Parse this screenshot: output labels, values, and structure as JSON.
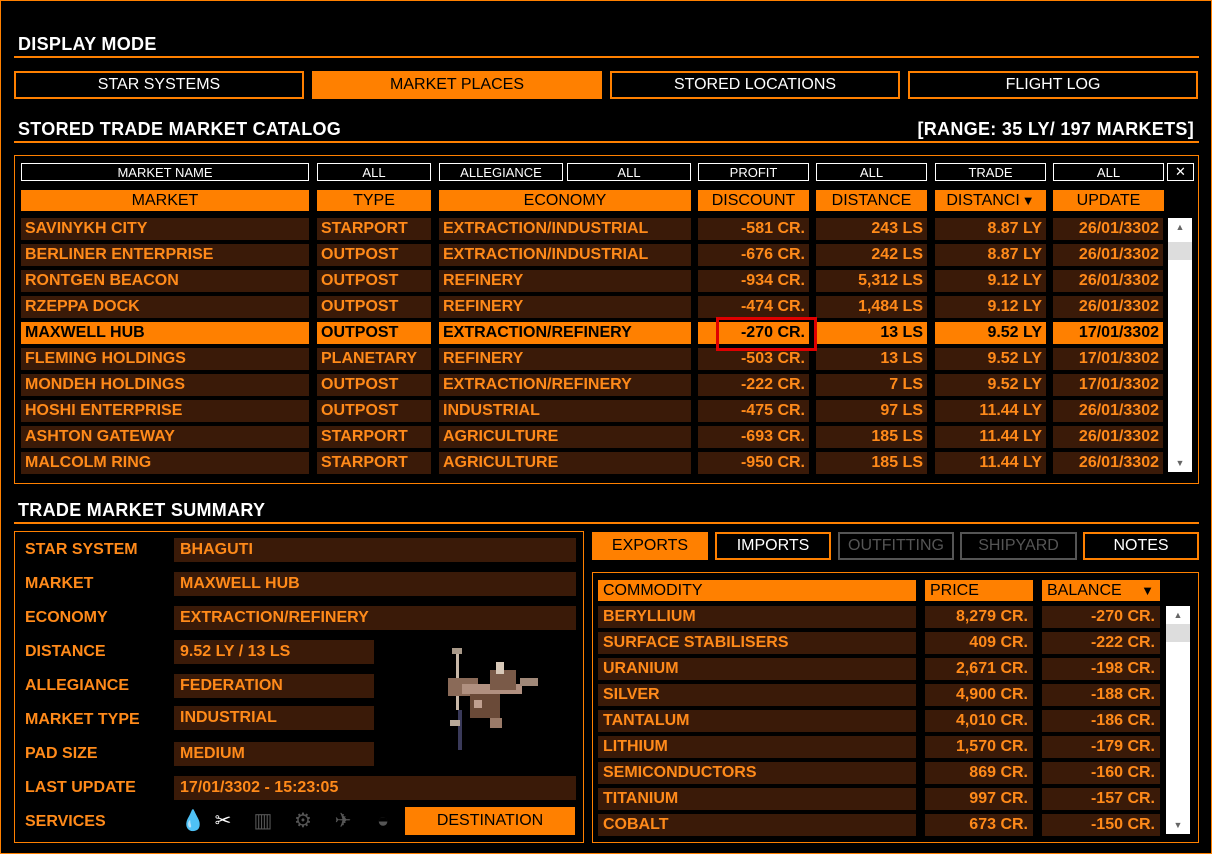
{
  "display_mode": {
    "title": "DISPLAY MODE",
    "buttons": [
      {
        "label": "STAR SYSTEMS"
      },
      {
        "label": "MARKET PLACES"
      },
      {
        "label": "STORED LOCATIONS"
      },
      {
        "label": "FLIGHT LOG"
      }
    ]
  },
  "catalog": {
    "title": "STORED TRADE MARKET CATALOG",
    "range": "[RANGE: 35 LY/ 197 MARKETS]",
    "filters": {
      "market_name": "MARKET NAME",
      "type_filter": "ALL",
      "allegiance": "ALLEGIANCE",
      "allegiance_filter": "ALL",
      "profit": "PROFIT",
      "profit_filter": "ALL",
      "trade": "TRADE",
      "trade_filter": "ALL",
      "close": "✕"
    },
    "columns": {
      "market": "MARKET",
      "type": "TYPE",
      "economy": "ECONOMY",
      "discount": "DISCOUNT",
      "distance": "DISTANCE",
      "distance_ly": "DISTANCI",
      "update": "UPDATE"
    },
    "rows": [
      {
        "market": "SAVINYKH CITY",
        "type": "STARPORT",
        "economy": "EXTRACTION/INDUSTRIAL",
        "discount": "-581 CR.",
        "distance": "243 LS",
        "distance_ly": "8.87 LY",
        "update": "26/01/3302"
      },
      {
        "market": "BERLINER ENTERPRISE",
        "type": "OUTPOST",
        "economy": "EXTRACTION/INDUSTRIAL",
        "discount": "-676 CR.",
        "distance": "242 LS",
        "distance_ly": "8.87 LY",
        "update": "26/01/3302"
      },
      {
        "market": "RONTGEN BEACON",
        "type": "OUTPOST",
        "economy": "REFINERY",
        "discount": "-934 CR.",
        "distance": "5,312 LS",
        "distance_ly": "9.12 LY",
        "update": "26/01/3302"
      },
      {
        "market": "RZEPPA DOCK",
        "type": "OUTPOST",
        "economy": "REFINERY",
        "discount": "-474 CR.",
        "distance": "1,484 LS",
        "distance_ly": "9.12 LY",
        "update": "26/01/3302"
      },
      {
        "market": "MAXWELL HUB",
        "type": "OUTPOST",
        "economy": "EXTRACTION/REFINERY",
        "discount": "-270 CR.",
        "distance": "13 LS",
        "distance_ly": "9.52 LY",
        "update": "17/01/3302"
      },
      {
        "market": "FLEMING HOLDINGS",
        "type": "PLANETARY",
        "economy": "REFINERY",
        "discount": "-503 CR.",
        "distance": "13 LS",
        "distance_ly": "9.52 LY",
        "update": "17/01/3302"
      },
      {
        "market": "MONDEH HOLDINGS",
        "type": "OUTPOST",
        "economy": "EXTRACTION/REFINERY",
        "discount": "-222 CR.",
        "distance": "7 LS",
        "distance_ly": "9.52 LY",
        "update": "17/01/3302"
      },
      {
        "market": "HOSHI ENTERPRISE",
        "type": "OUTPOST",
        "economy": "INDUSTRIAL",
        "discount": "-475 CR.",
        "distance": "97 LS",
        "distance_ly": "11.44 LY",
        "update": "26/01/3302"
      },
      {
        "market": "ASHTON GATEWAY",
        "type": "STARPORT",
        "economy": "AGRICULTURE",
        "discount": "-693 CR.",
        "distance": "185 LS",
        "distance_ly": "11.44 LY",
        "update": "26/01/3302"
      },
      {
        "market": "MALCOLM RING",
        "type": "STARPORT",
        "economy": "AGRICULTURE",
        "discount": "-950 CR.",
        "distance": "185 LS",
        "distance_ly": "11.44 LY",
        "update": "26/01/3302"
      }
    ]
  },
  "summary": {
    "title": "TRADE MARKET SUMMARY",
    "fields": {
      "star_system": {
        "label": "STAR SYSTEM",
        "value": "BHAGUTI"
      },
      "market": {
        "label": "MARKET",
        "value": "MAXWELL HUB"
      },
      "economy": {
        "label": "ECONOMY",
        "value": "EXTRACTION/REFINERY"
      },
      "distance": {
        "label": "DISTANCE",
        "value": "9.52 LY / 13 LS"
      },
      "allegiance": {
        "label": "ALLEGIANCE",
        "value": "FEDERATION"
      },
      "market_type": {
        "label": "MARKET TYPE",
        "value": "INDUSTRIAL"
      },
      "pad_size": {
        "label": "PAD SIZE",
        "value": "MEDIUM"
      },
      "last_update": {
        "label": "LAST UPDATE",
        "value": "17/01/3302 - 15:23:05"
      },
      "services": {
        "label": "SERVICES"
      }
    },
    "services_icons": [
      "refuel-icon",
      "repair-icon",
      "rearm-icon",
      "outfitting-icon",
      "shipyard-icon",
      "black-market-icon"
    ],
    "destination_label": "DESTINATION"
  },
  "tabs": [
    {
      "label": "EXPORTS"
    },
    {
      "label": "IMPORTS"
    },
    {
      "label": "OUTFITTING"
    },
    {
      "label": "SHIPYARD"
    },
    {
      "label": "NOTES"
    }
  ],
  "commodities": {
    "columns": {
      "commodity": "COMMODITY",
      "price": "PRICE",
      "balance": "BALANCE"
    },
    "rows": [
      {
        "name": "BERYLLIUM",
        "price": "8,279 CR.",
        "balance": "-270 CR."
      },
      {
        "name": "SURFACE STABILISERS",
        "price": "409 CR.",
        "balance": "-222 CR."
      },
      {
        "name": "URANIUM",
        "price": "2,671 CR.",
        "balance": "-198 CR."
      },
      {
        "name": "SILVER",
        "price": "4,900 CR.",
        "balance": "-188 CR."
      },
      {
        "name": "TANTALUM",
        "price": "4,010 CR.",
        "balance": "-186 CR."
      },
      {
        "name": "LITHIUM",
        "price": "1,570 CR.",
        "balance": "-179 CR."
      },
      {
        "name": "SEMICONDUCTORS",
        "price": "869 CR.",
        "balance": "-160 CR."
      },
      {
        "name": "TITANIUM",
        "price": "997 CR.",
        "balance": "-157 CR."
      },
      {
        "name": "COBALT",
        "price": "673 CR.",
        "balance": "-150 CR."
      }
    ]
  },
  "colors": {
    "accent": "#ff8000",
    "row_bg": "#3a1a08",
    "row_text": "#ff8a1a",
    "highlight": "#e00000"
  }
}
